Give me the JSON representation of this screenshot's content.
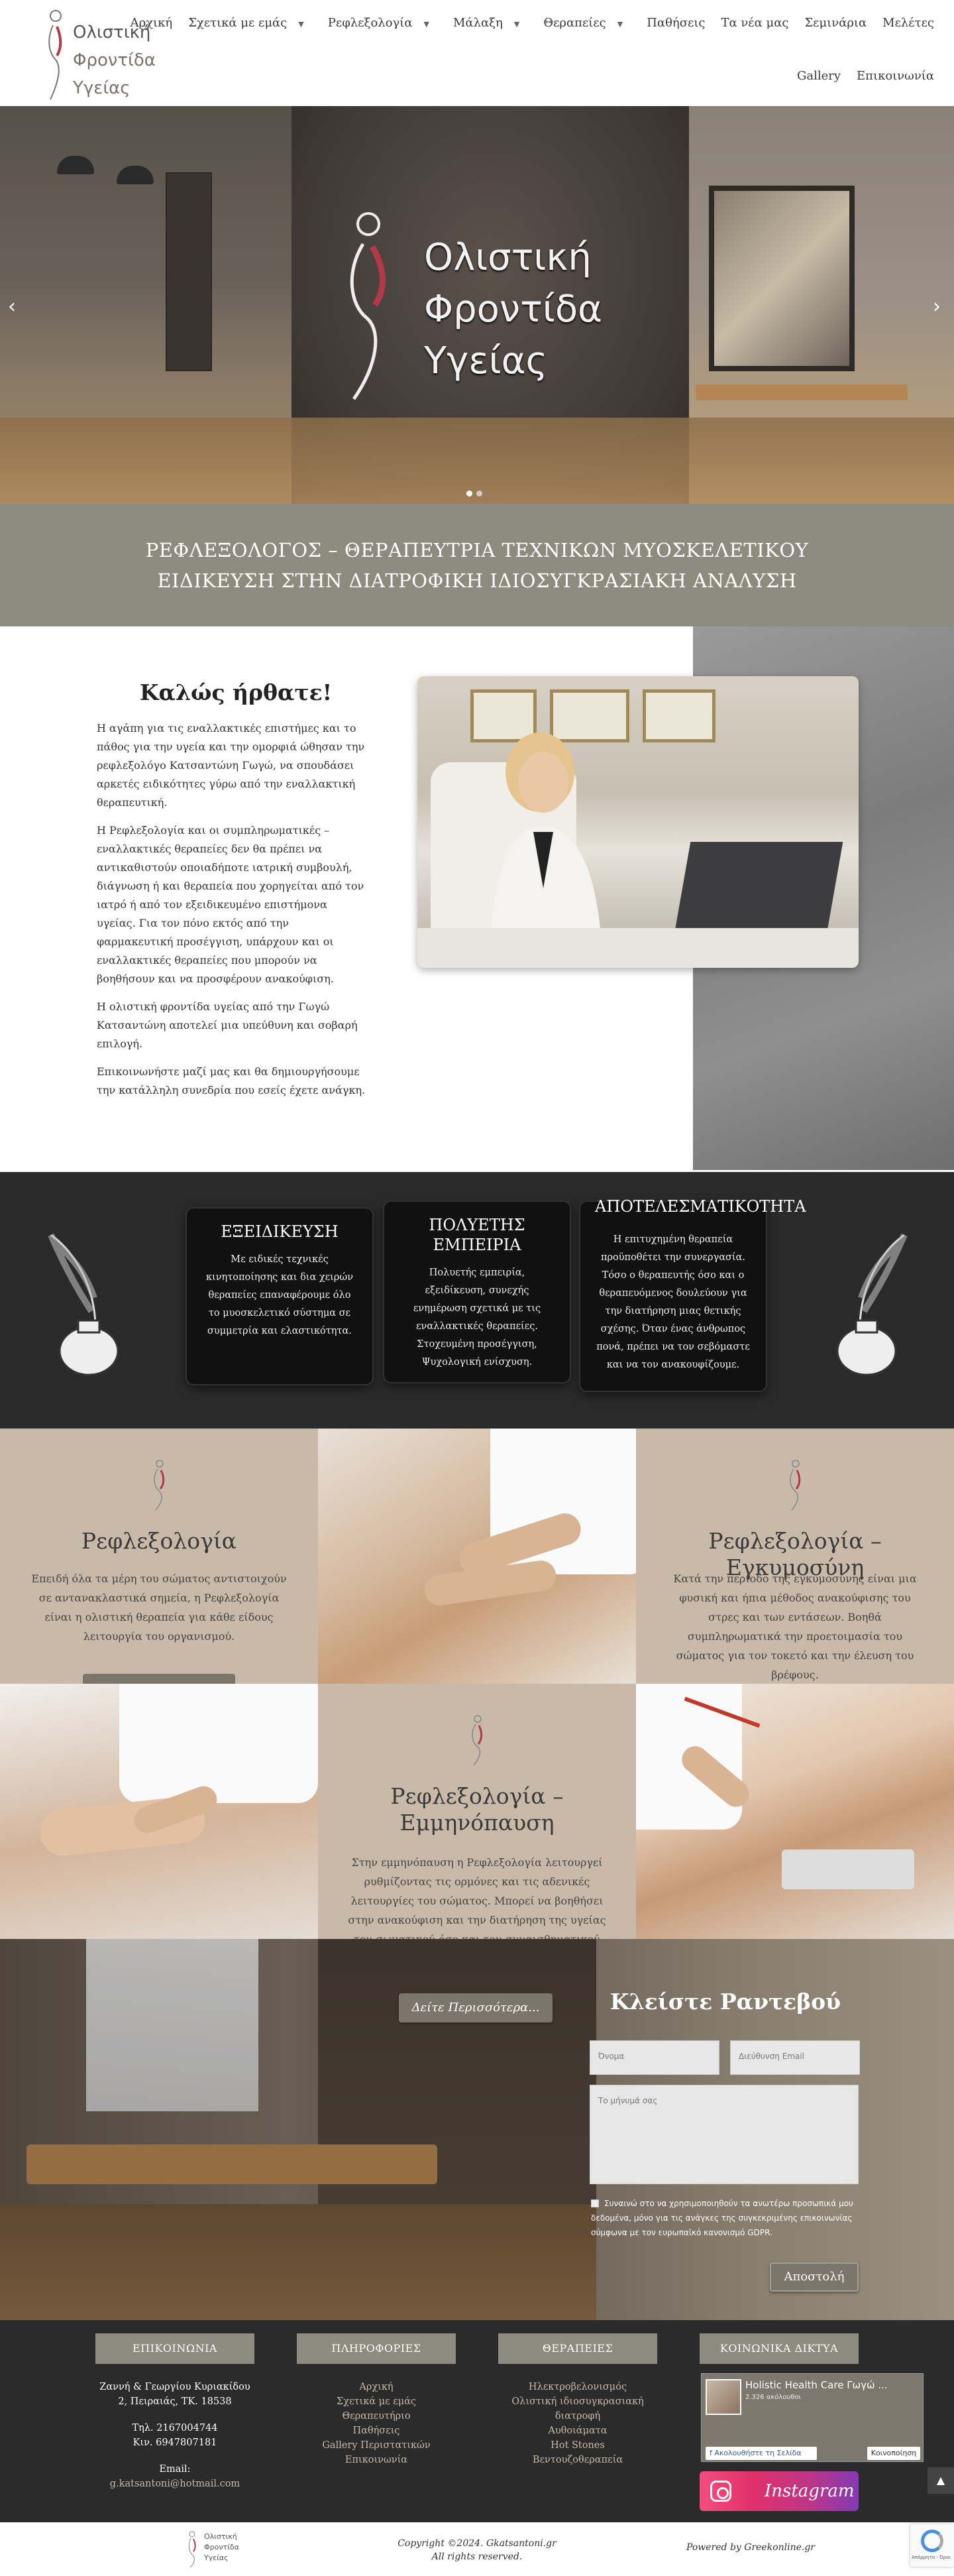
{
  "brand": {
    "logo_lines": [
      "Ολιστική",
      "Φροντίδα",
      "Υγείας"
    ],
    "accent": "#c8b9a8",
    "banner_color": "#8d8a7e",
    "button_color": "#7b756c"
  },
  "nav": {
    "row1": [
      {
        "label": "Αρχική",
        "dropdown": false
      },
      {
        "label": "Σχετικά με εμάς",
        "dropdown": true
      },
      {
        "label": "Ρεφλεξολογία",
        "dropdown": true
      },
      {
        "label": "Μάλαξη",
        "dropdown": true
      },
      {
        "label": "Θεραπείες",
        "dropdown": true
      },
      {
        "label": "Παθήσεις",
        "dropdown": false
      },
      {
        "label": "Τα νέα μας",
        "dropdown": false
      },
      {
        "label": "Σεμινάρια",
        "dropdown": false
      },
      {
        "label": "Μελέτες",
        "dropdown": false
      }
    ],
    "row2": [
      "Gallery",
      "Επικοινωνία"
    ]
  },
  "hero": {
    "title_lines": [
      "Ολιστική",
      "Φροντίδα",
      "Υγείας"
    ],
    "prev_icon": "chevron-left-icon",
    "next_icon": "chevron-right-icon",
    "slides": 2,
    "active_slide": 1
  },
  "banner": {
    "line1": "ΡΕΦΛΕΞΟΛΟΓΟΣ – ΘΕΡΑΠΕΥΤΡΙΑ ΤΕΧΝΙΚΩΝ ΜΥΟΣΚΕΛΕΤΙΚΟΥ",
    "line2": "ΕΙΔΙΚΕΥΣΗ ΣΤΗΝ ΔΙΑΤΡΟΦΙΚΗ ΙΔΙΟΣΥΓΚΡΑΣΙΑΚΗ ΑΝΑΛΥΣΗ"
  },
  "welcome": {
    "title": "Καλώς ήρθατε!",
    "paragraphs": [
      "Η αγάπη για τις εναλλακτικές επιστήμες και το πάθος για την υγεία και την ομορφιά ώθησαν την ρεφλεξολόγο Κατσαντώνη Γωγώ, να σπουδάσει αρκετές ειδικότητες γύρω από την εναλλακτική θεραπευτική.",
      "Η Ρεφλεξολογία και οι συμπληρωματικές – εναλλακτικές θεραπείες δεν θα πρέπει να αντικαθιστούν οποιαδήποτε ιατρική συμβουλή, διάγνωση ή και θεραπεία που χορηγείται από τον ιατρό ή από τον εξειδικευμένο επιστήμονα υγείας. Για τον πόνο εκτός από την φαρμακευτική προσέγγιση, υπάρχουν και οι εναλλακτικές θεραπείες που μπορούν να βοηθήσουν και να προσφέρουν ανακούφιση.",
      "Η ολιστική φροντίδα υγείας από την Γωγώ Κατσαντώνη αποτελεί μια υπεύθυνη και σοβαρή επιλογή.",
      "Επικοινωνήστε μαζί μας και θα δημιουργήσουμε την κατάλληλη συνεδρία που εσείς έχετε ανάγκη."
    ]
  },
  "features": [
    {
      "title": "ΕΞΕΙΔΙΚΕΥΣΗ",
      "text": "Με ειδικές τεχνικές κινητοποίησης και δια χειρών θεραπείες επαναφέρουμε όλο το μυοσκελετικό σύστημα σε συμμετρία και ελαστικότητα."
    },
    {
      "title": "ΠΟΛΥΕΤΗΣ ΕΜΠΕΙΡΙΑ",
      "text": "Πολυετής εμπειρία, εξειδίκευση, συνεχής ενημέρωση σχετικά με τις εναλλακτικές θεραπείες. Στοχευμένη προσέγγιση, Ψυχολογική ενίσχυση."
    },
    {
      "title": "ΑΠΟΤΕΛΕΣΜΑΤΙΚΟΤΗΤΑ",
      "text": "Η επιτυχημένη θεραπεία προϋποθέτει την συνεργασία. Τόσο ο θεραπευτής όσο και ο θεραπευόμενος δουλεύουν για την διατήρηση μιας θετικής σχέσης. Όταν ένας άνθρωπος πονά, πρέπει να τον σεβόμαστε και να τον ανακουφίζουμε."
    }
  ],
  "services": [
    {
      "title": "Ρεφλεξολογία",
      "text": "Επειδή όλα τα μέρη του σώματος αντιστοιχούν σε αντανακλαστικά σημεία, η Ρεφλεξολογία είναι η ολιστική θεραπεία για κάθε είδους λειτουργία του οργανισμού."
    },
    {
      "title": "Ρεφλεξολογία – Εγκυμοσύνη",
      "text": "Κατά την περίοδο της εγκυμοσύνης είναι μια φυσική και ήπια μέθοδος ανακούφισης του στρες και των εντάσεων. Βοηθά συμπληρωματικά την προετοιμασία του σώματος για τον τοκετό και την έλευση του βρέφους."
    },
    {
      "title": "Ρεφλεξολογία – Εμμηνόπαυση",
      "text": "Στην εμμηνόπαυση η Ρεφλεξολογία λειτουργεί ρυθμίζοντας τις ορμόνες και τις αδενικές λειτουργίες του σώματος. Μπορεί να βοηθήσει στην ανακούφιση και την διατήρηση της υγείας του σωματικού όσο και του συναισθηματικού συστήματος."
    }
  ],
  "more_button": "Δείτε Περισσότερα...",
  "appointment": {
    "title": "Κλείστε Ραντεβού",
    "name_placeholder": "Όνομα",
    "email_placeholder": "Διεύθυνση Email",
    "message_placeholder": "Το μήνυμά σας",
    "consent": "Συναινώ στο να χρησιμοποιηθούν τα ανωτέρω προσωπικά μου δεδομένα, μόνο για τις ανάγκες της συγκεκριμένης επικοινωνίας σύμφωνα με τον ευρωπαϊκό κανονισμό GDPR.",
    "submit": "Αποστολή"
  },
  "footer": {
    "contact": {
      "heading": "ΕΠΙΚΟΙΝΩΝΙΑ",
      "address1": "Ζαννή & Γεωργίου Κυριακίδου",
      "address2": "2, Πειραιάς, ΤΚ. 18538",
      "phone": "Τηλ. 2167004744",
      "mobile": "Κιν. 6947807181",
      "email_label": "Email:",
      "email": "g.katsantoni@hotmail.com"
    },
    "info": {
      "heading": "ΠΛΗΡΟΦΟΡΙΕΣ",
      "links": [
        "Αρχική",
        "Σχετικά με εμάς",
        "Θεραπευτήριο",
        "Παθήσεις",
        "Gallery Περιστατικών",
        "Επικοινωνία"
      ]
    },
    "therapies": {
      "heading": "ΘΕΡΑΠΕΙΕΣ",
      "links": [
        "Ηλεκτροβελονισμός",
        "Ολιστική ιδιοσυγκρασιακή διατροφή",
        "Αυθοιάματα",
        "Hot Stones",
        "Βεντουζοθεραπεία"
      ]
    },
    "social": {
      "heading": "ΚΟΙΝΩΝΙΚΑ ΔΙΚΤΥΑ",
      "fb_name": "Holistic Health Care Γωγώ ...",
      "fb_likes": "2.326 ακόλουθοι",
      "fb_follow": "Ακολουθήστε τη Σελίδα",
      "fb_share": "Κοινοποίηση",
      "instagram": "Instagram"
    },
    "copyright1": "Copyright ©2024. Gkatsantoni.gr",
    "copyright2": "All rights reserved.",
    "powered": "Powered by Greekonline.gr"
  },
  "recaptcha": {
    "label": "Απόρρητο - Όροι"
  }
}
